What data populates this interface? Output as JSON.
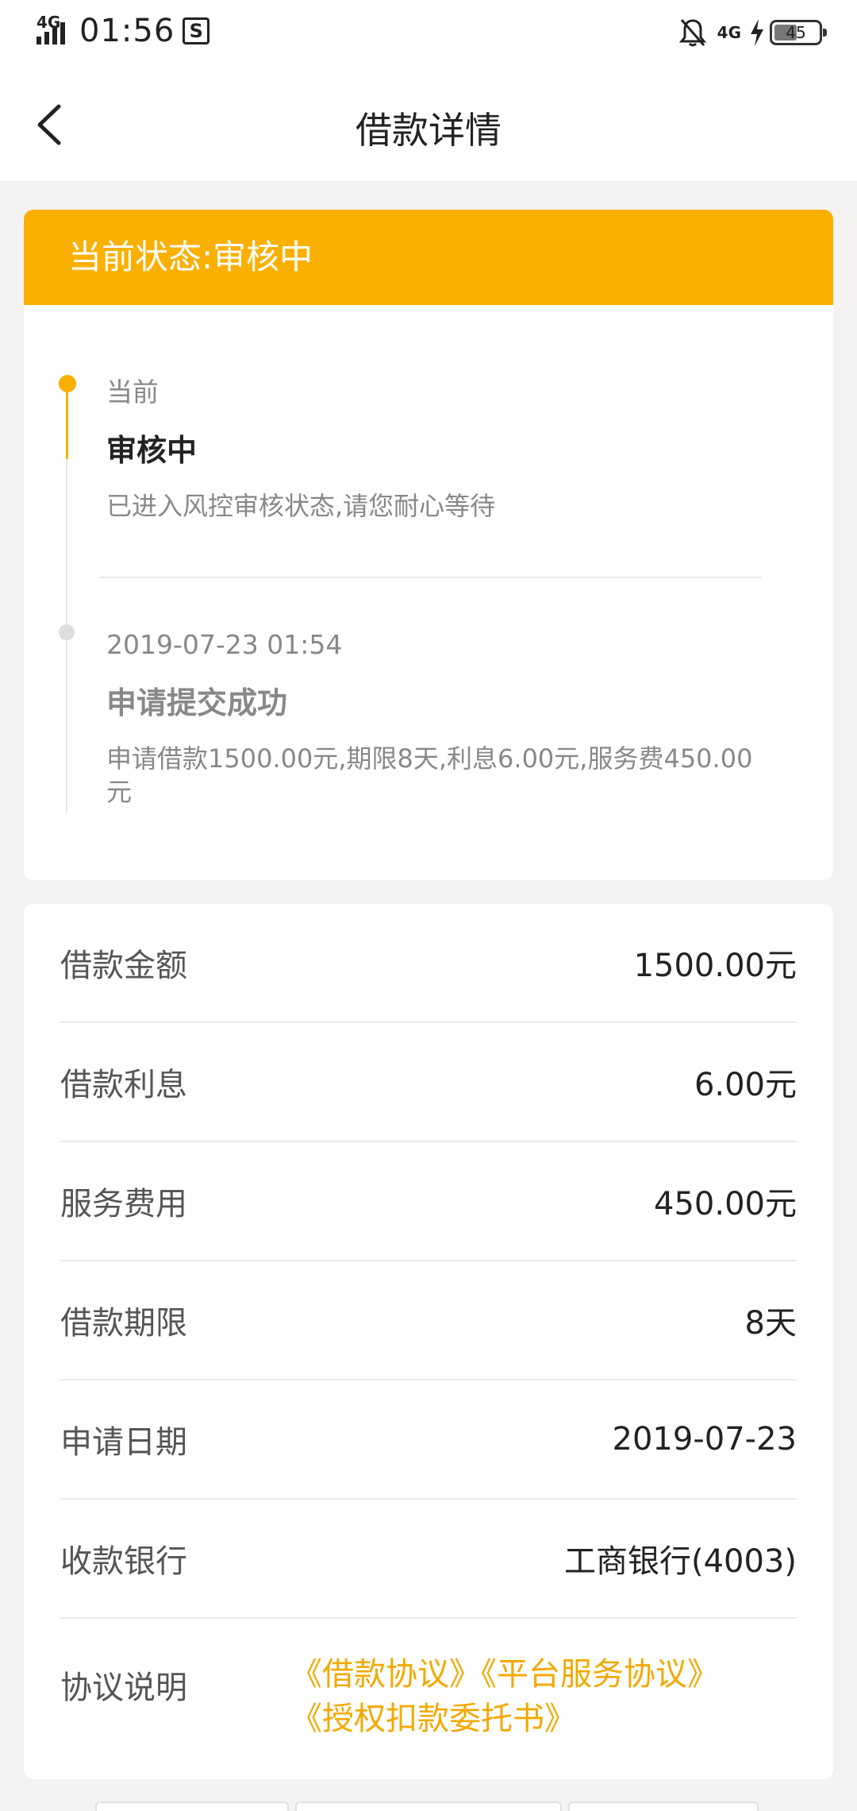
{
  "status_bar": {
    "network_left": "4G",
    "time": "01:56",
    "s_badge": "S",
    "network_right": "4G",
    "battery_level": "45",
    "icons": [
      "signal-icon",
      "sim-s-icon",
      "bell-muted-icon",
      "charging-bolt-icon",
      "battery-icon"
    ]
  },
  "nav": {
    "title": "借款详情",
    "back_icon": "chevron-left-icon"
  },
  "status": {
    "header": "当前状态:审核中",
    "accent_color": "#fbb000",
    "timeline": [
      {
        "tag": "当前",
        "title": "审核中",
        "desc": "已进入风控审核状态,请您耐心等待",
        "active": true
      },
      {
        "tag": "2019-07-23 01:54",
        "title": "申请提交成功",
        "desc": "申请借款1500.00元,期限8天,利息6.00元,服务费450.00元",
        "active": false
      }
    ]
  },
  "details": {
    "rows": [
      {
        "label": "借款金额",
        "value": "1500.00元"
      },
      {
        "label": "借款利息",
        "value": "6.00元"
      },
      {
        "label": "服务费用",
        "value": "450.00元"
      },
      {
        "label": "借款期限",
        "value": "8天"
      },
      {
        "label": "申请日期",
        "value": "2019-07-23"
      },
      {
        "label": "收款银行",
        "value": "工商银行(4003)"
      }
    ],
    "agreement": {
      "label": "协议说明",
      "links": [
        "《借款协议》",
        "《平台服务协议》",
        "《授权扣款委托书》"
      ],
      "link_color": "#f2a900"
    }
  }
}
